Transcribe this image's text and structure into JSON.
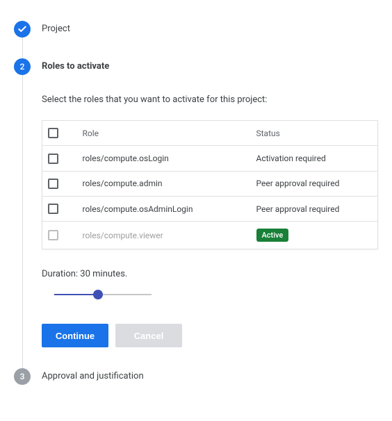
{
  "steps": {
    "project": {
      "title": "Project"
    },
    "roles": {
      "title": "Roles to activate",
      "instruction": "Select the roles that you want to activate for this project:",
      "table": {
        "headers": {
          "role": "Role",
          "status": "Status"
        },
        "rows": [
          {
            "role": "roles/compute.osLogin",
            "status": "Activation required",
            "badge": false,
            "disabled": false
          },
          {
            "role": "roles/compute.admin",
            "status": "Peer approval required",
            "badge": false,
            "disabled": false
          },
          {
            "role": "roles/compute.osAdminLogin",
            "status": "Peer approval required",
            "badge": false,
            "disabled": false
          },
          {
            "role": "roles/compute.viewer",
            "status": "Active",
            "badge": true,
            "disabled": true
          }
        ]
      },
      "duration": {
        "label": "Duration: 30 minutes."
      },
      "buttons": {
        "continue": "Continue",
        "cancel": "Cancel"
      }
    },
    "approval": {
      "number": "3",
      "title": "Approval and justification"
    }
  }
}
